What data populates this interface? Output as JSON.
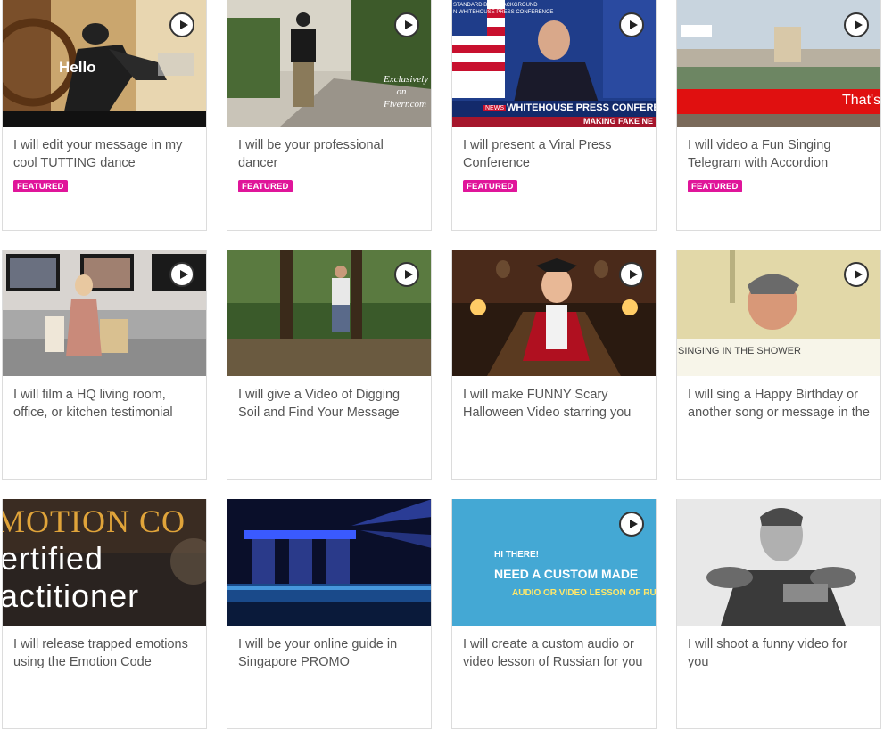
{
  "cards": [
    {
      "title": "I will edit your message in my cool TUTTING dance",
      "badge": "FEATURED",
      "thumb_text": "Hello"
    },
    {
      "title": "I will be your professional dancer",
      "badge": "FEATURED",
      "thumb_text": "Exclusively on Fiverr.com"
    },
    {
      "title": "I will present a Viral Press Conference",
      "badge": "FEATURED",
      "thumb_text": "WHITEHOUSE PRESS CONFERENCE",
      "thumb_text2": "MAKING FAKE NE",
      "thumb_text3": "STANDARD BLUE BACKGROUND",
      "thumb_text4": "N WHITEHOUSE PRESS CONFERENCE",
      "thumb_text5": "NEWS"
    },
    {
      "title": "I will video a Fun Singing Telegram with Accordion",
      "badge": "FEATURED",
      "thumb_text": "That's"
    },
    {
      "title": "I will film a HQ living room, office, or kitchen testimonial"
    },
    {
      "title": "I will give a Video of Digging Soil and Find Your Message"
    },
    {
      "title": "I will make FUNNY Scary Halloween Video starring you"
    },
    {
      "title": "I will sing a Happy Birthday or another song or message in the",
      "thumb_text": "SINGING IN THE SHOWER"
    },
    {
      "title": "I will release trapped emotions using the Emotion Code",
      "thumb_text": "MOTION CO",
      "thumb_text2": "ertified",
      "thumb_text3": "actitioner"
    },
    {
      "title": "I will be your online guide in Singapore PROMO"
    },
    {
      "title": "I will create a custom audio or video lesson of Russian for you",
      "thumb_text": "HI THERE!",
      "thumb_text2": "NEED A CUSTOM MADE",
      "thumb_text3": "AUDIO OR VIDEO LESSON OF RUSSIAN?"
    },
    {
      "title": "I will shoot a funny video for you"
    }
  ]
}
